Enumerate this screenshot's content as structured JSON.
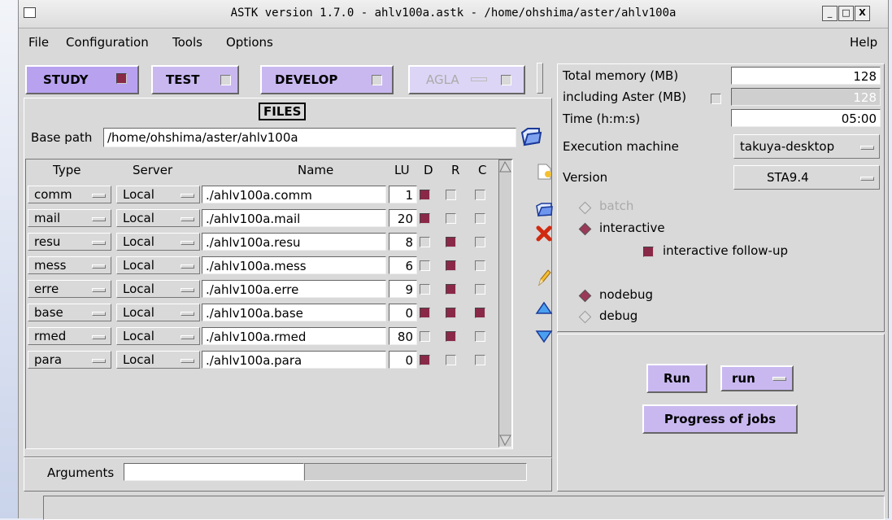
{
  "window": {
    "title": "ASTK version 1.7.0 - ahlv100a.astk - /home/ohshima/aster/ahlv100a",
    "controls": [
      "_",
      "□",
      "X"
    ]
  },
  "menu": {
    "file": "File",
    "configuration": "Configuration",
    "tools": "Tools",
    "options": "Options",
    "help": "Help"
  },
  "modes": {
    "study": "STUDY",
    "test": "TEST",
    "develop": "DEVELOP",
    "agla": "AGLA"
  },
  "files": {
    "title": "FILES",
    "base_path_label": "Base path",
    "base_path": "/home/ohshima/aster/ahlv100a",
    "headers": {
      "type": "Type",
      "server": "Server",
      "name": "Name",
      "lu": "LU",
      "d": "D",
      "r": "R",
      "c": "C"
    },
    "rows": [
      {
        "type": "comm",
        "server": "Local",
        "name": "./ahlv100a.comm",
        "lu": "1",
        "d": true,
        "r": false,
        "c": false
      },
      {
        "type": "mail",
        "server": "Local",
        "name": "./ahlv100a.mail",
        "lu": "20",
        "d": true,
        "r": false,
        "c": false
      },
      {
        "type": "resu",
        "server": "Local",
        "name": "./ahlv100a.resu",
        "lu": "8",
        "d": false,
        "r": true,
        "c": false
      },
      {
        "type": "mess",
        "server": "Local",
        "name": "./ahlv100a.mess",
        "lu": "6",
        "d": false,
        "r": true,
        "c": false
      },
      {
        "type": "erre",
        "server": "Local",
        "name": "./ahlv100a.erre",
        "lu": "9",
        "d": false,
        "r": true,
        "c": false
      },
      {
        "type": "base",
        "server": "Local",
        "name": "./ahlv100a.base",
        "lu": "0",
        "d": true,
        "r": true,
        "c": true
      },
      {
        "type": "rmed",
        "server": "Local",
        "name": "./ahlv100a.rmed",
        "lu": "80",
        "d": false,
        "r": true,
        "c": false
      },
      {
        "type": "para",
        "server": "Local",
        "name": "./ahlv100a.para",
        "lu": "0",
        "d": true,
        "r": false,
        "c": false
      }
    ],
    "arguments_label": "Arguments",
    "arguments_value": ""
  },
  "settings": {
    "total_memory_label": "Total memory (MB)",
    "total_memory": "128",
    "including_aster_label": "including Aster (MB)",
    "including_aster": "128",
    "time_label": "Time (h:m:s)",
    "time": "05:00",
    "machine_label": "Execution machine",
    "machine": "takuya-desktop",
    "version_label": "Version",
    "version": "STA9.4",
    "batch": "batch",
    "interactive": "interactive",
    "follow_up": "interactive follow-up",
    "nodebug": "nodebug",
    "debug": "debug"
  },
  "actions": {
    "run": "Run",
    "run_mode": "run",
    "progress": "Progress of jobs"
  },
  "colors": {
    "accent": "#c9b8f0",
    "checked": "#8a2848"
  }
}
